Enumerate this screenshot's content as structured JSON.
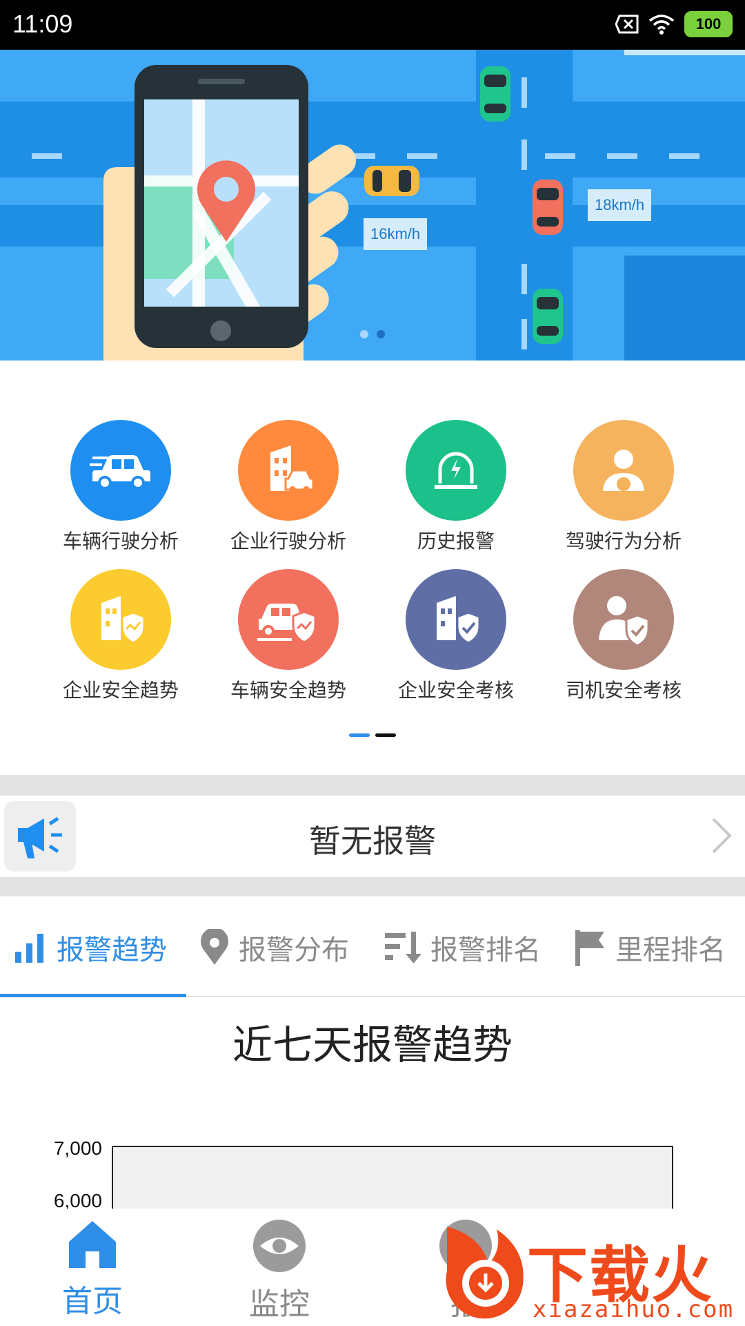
{
  "status": {
    "time": "11:09",
    "battery": "100"
  },
  "banner": {
    "speed_left": "16km/h",
    "speed_right": "18km/h",
    "slide_count": 2,
    "active_slide": 2
  },
  "features": [
    {
      "label": "车辆行驶分析",
      "icon": "car-speed-icon",
      "color": "#1e8ff0"
    },
    {
      "label": "企业行驶分析",
      "icon": "building-car-icon",
      "color": "#ff8a3d"
    },
    {
      "label": "历史报警",
      "icon": "siren-icon",
      "color": "#1bc08a"
    },
    {
      "label": "驾驶行为分析",
      "icon": "driver-icon",
      "color": "#f5b35e"
    },
    {
      "label": "企业安全趋势",
      "icon": "building-shield-trend-icon",
      "color": "#fbcb2f"
    },
    {
      "label": "车辆安全趋势",
      "icon": "car-shield-trend-icon",
      "color": "#f2705e"
    },
    {
      "label": "企业安全考核",
      "icon": "building-shield-check-icon",
      "color": "#5f6fa6"
    },
    {
      "label": "司机安全考核",
      "icon": "driver-shield-check-icon",
      "color": "#b0877a"
    }
  ],
  "alert": {
    "text": "暂无报警"
  },
  "tabs": [
    {
      "label": "报警趋势",
      "icon": "bar-chart-icon"
    },
    {
      "label": "报警分布",
      "icon": "location-pin-icon"
    },
    {
      "label": "报警排名",
      "icon": "sort-icon"
    },
    {
      "label": "里程排名",
      "icon": "flag-icon"
    }
  ],
  "chart_title": "近七天报警趋势",
  "chart_data": {
    "type": "line",
    "title": "近七天报警趋势",
    "y_ticks": [
      "7,000",
      "6,000"
    ],
    "ylim": [
      6000,
      7000
    ]
  },
  "bottom_nav": [
    {
      "label": "首页",
      "icon": "home-icon"
    },
    {
      "label": "监控",
      "icon": "eye-icon"
    },
    {
      "label": "报",
      "icon": "alarm-icon"
    }
  ],
  "watermark": {
    "text": "下载火",
    "url": "xiazaihuo.com"
  },
  "colors": {
    "primary": "#2f8ee8",
    "inactive": "#8a8a8a"
  }
}
